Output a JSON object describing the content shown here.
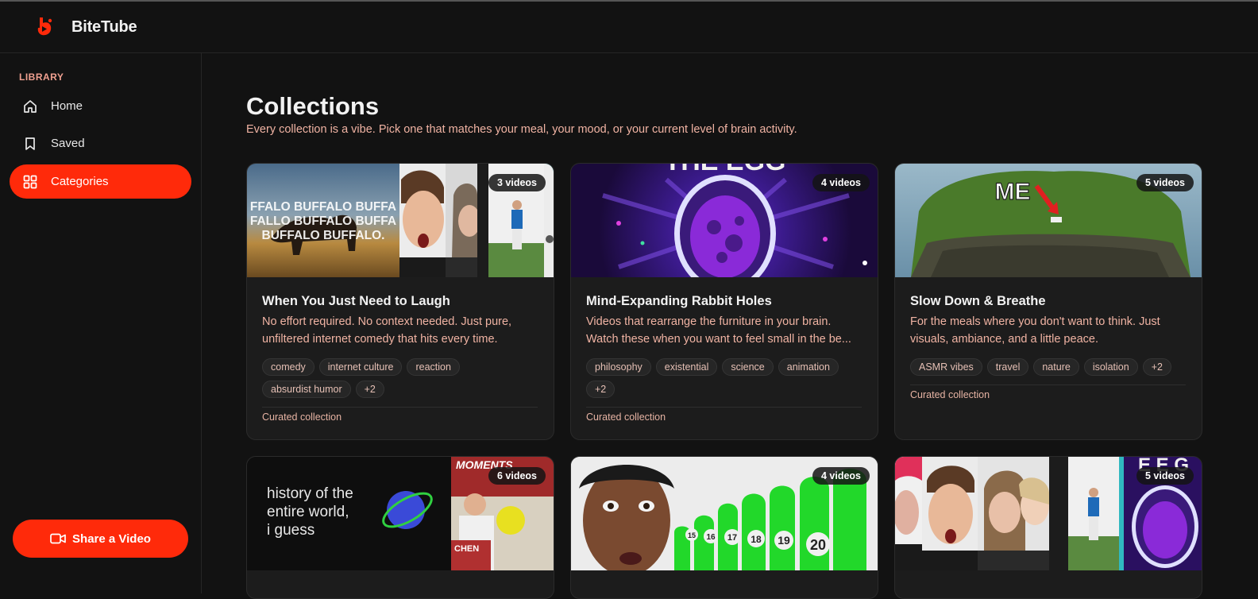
{
  "app": {
    "name": "BiteTube",
    "brand_color": "#ff2a0a"
  },
  "sidebar": {
    "section_label": "LIBRARY",
    "items": [
      {
        "label": "Home",
        "icon": "home-icon",
        "active": false
      },
      {
        "label": "Saved",
        "icon": "bookmark-icon",
        "active": false
      },
      {
        "label": "Categories",
        "icon": "grid-icon",
        "active": true
      }
    ],
    "share_label": "Share a Video"
  },
  "page": {
    "title": "Collections",
    "subtitle": "Every collection is a vibe. Pick one that matches your meal, your mood, or your current level of brain activity."
  },
  "collections": [
    {
      "badge": "3 videos",
      "title": "When You Just Need to Laugh",
      "description": "No effort required. No context needed. Just pure, unfiltered internet comedy that hits every time.",
      "tags": [
        "comedy",
        "internet culture",
        "reaction",
        "absurdist humor",
        "+2"
      ],
      "footer": "Curated collection",
      "thumb_text": [
        "FFALO BUFFALO BUFFA",
        "FALLO BUFFALO BUFFA",
        "BUFFALO BUFFALO."
      ]
    },
    {
      "badge": "4 videos",
      "title": "Mind-Expanding Rabbit Holes",
      "description": "Videos that rearrange the furniture in your brain. Watch these when you want to feel small in the be...",
      "tags": [
        "philosophy",
        "existential",
        "science",
        "animation",
        "+2"
      ],
      "footer": "Curated collection",
      "thumb_text": "THE EGG"
    },
    {
      "badge": "5 videos",
      "title": "Slow Down & Breathe",
      "description": "For the meals where you don't want to think. Just visuals, ambiance, and a little peace.",
      "tags": [
        "ASMR vibes",
        "travel",
        "nature",
        "isolation",
        "+2"
      ],
      "footer": "Curated collection",
      "thumb_text": "ME"
    },
    {
      "badge": "6 videos",
      "thumb_text": [
        "history of the",
        "entire world,",
        "i guess"
      ],
      "thumb_text_right": "MOMENTS",
      "thumb_text_bottom": "CHEN"
    },
    {
      "badge": "4 videos",
      "thumb_numbers": [
        "15",
        "16",
        "17",
        "18",
        "19",
        "20"
      ]
    },
    {
      "badge": "5 videos",
      "thumb_text": "E E G"
    }
  ]
}
